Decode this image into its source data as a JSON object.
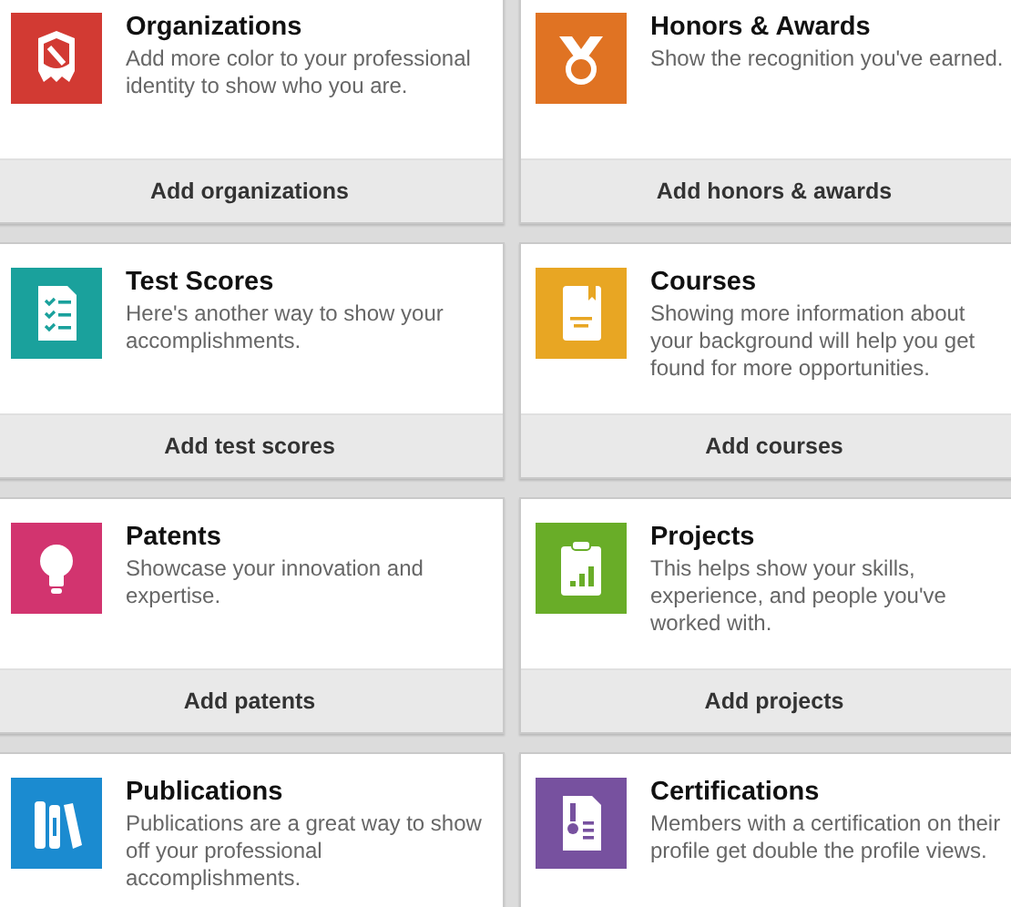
{
  "cards": [
    {
      "kind": "organizations",
      "color": "#d23a33",
      "title": "Organizations",
      "description": "Add more color to your professional identity to show who you are.",
      "button": "Add organizations"
    },
    {
      "kind": "honors",
      "color": "#e07323",
      "title": "Honors & Awards",
      "description": "Show the recognition you've earned.",
      "button": "Add honors & awards"
    },
    {
      "kind": "test-scores",
      "color": "#1aa19c",
      "title": "Test Scores",
      "description": "Here's another way to show your accomplishments.",
      "button": "Add test scores"
    },
    {
      "kind": "courses",
      "color": "#e8a623",
      "title": "Courses",
      "description": "Showing more information about your background will help you get found for more opportunities.",
      "button": "Add courses"
    },
    {
      "kind": "patents",
      "color": "#d2346f",
      "title": "Patents",
      "description": "Showcase your innovation and expertise.",
      "button": "Add patents"
    },
    {
      "kind": "projects",
      "color": "#69ad28",
      "title": "Projects",
      "description": "This helps show your skills, experience, and people you've worked with.",
      "button": "Add projects"
    },
    {
      "kind": "publications",
      "color": "#1b8bd0",
      "title": "Publications",
      "description": "Publications are a great way to show off your professional accomplishments."
    },
    {
      "kind": "certifications",
      "color": "#77519f",
      "title": "Certifications",
      "description": "Members with a certification on their profile get double the profile views."
    }
  ]
}
